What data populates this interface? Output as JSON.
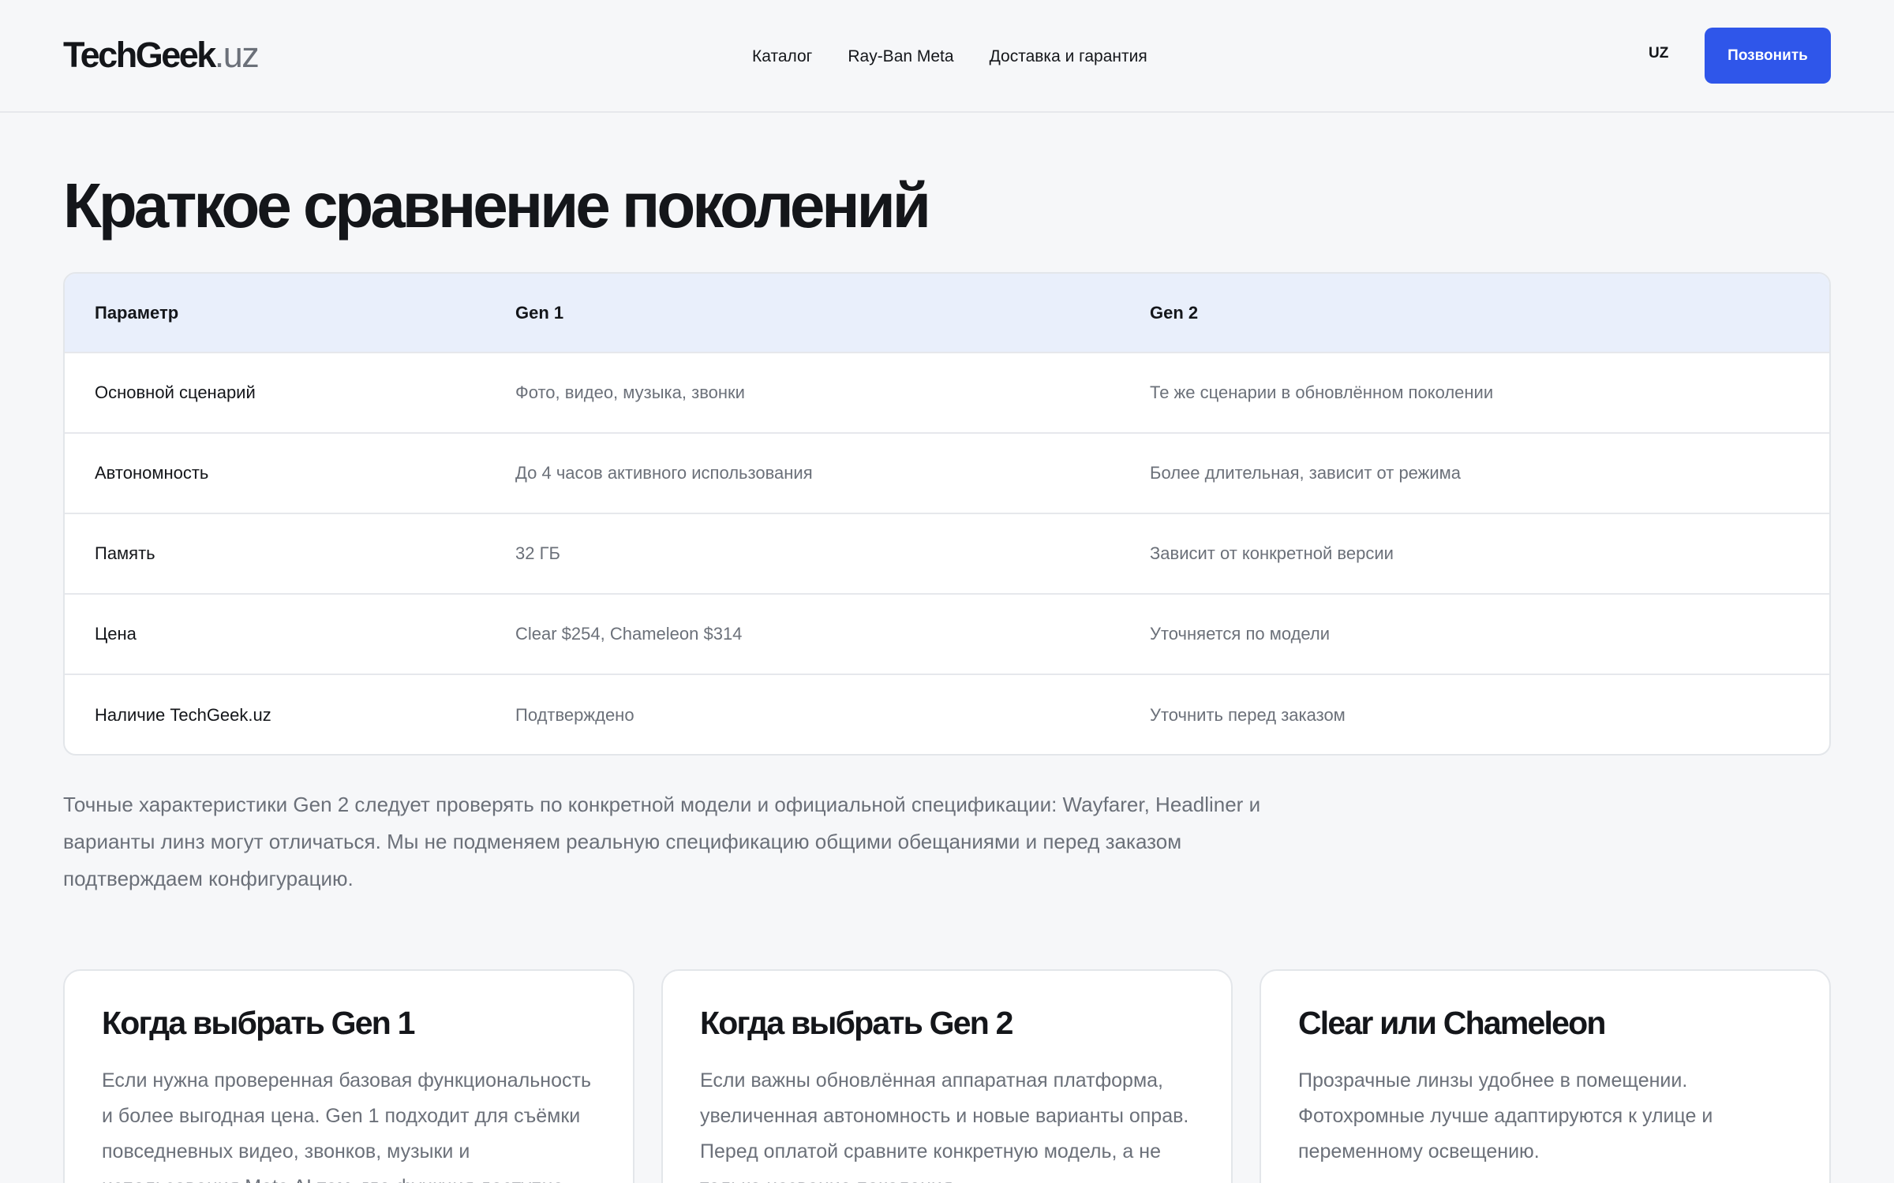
{
  "header": {
    "logo_main": "TechGeek",
    "logo_domain": ".uz",
    "nav": [
      {
        "label": "Каталог"
      },
      {
        "label": "Ray-Ban Meta"
      },
      {
        "label": "Доставка и гарантия"
      }
    ],
    "lang": "UZ",
    "call_label": "Позвонить"
  },
  "title": "Краткое сравнение поколений",
  "table": {
    "headers": [
      "Параметр",
      "Gen 1",
      "Gen 2"
    ],
    "rows": [
      [
        "Основной сценарий",
        "Фото, видео, музыка, звонки",
        "Те же сценарии в обновлённом поколении"
      ],
      [
        "Автономность",
        "До 4 часов активного использования",
        "Более длительная, зависит от режима"
      ],
      [
        "Память",
        "32 ГБ",
        "Зависит от конкретной версии"
      ],
      [
        "Цена",
        "Clear $254, Chameleon $314",
        "Уточняется по модели"
      ],
      [
        "Наличие TechGeek.uz",
        "Подтверждено",
        "Уточнить перед заказом"
      ]
    ]
  },
  "note": "Точные характеристики Gen 2 следует проверять по конкретной модели и официальной спецификации: Wayfarer, Headliner и варианты линз могут отличаться. Мы не подменяем реальную спецификацию общими обещаниями и перед заказом подтверждаем конфигурацию.",
  "cards": [
    {
      "title": "Когда выбрать Gen 1",
      "text": "Если нужна проверенная базовая функциональность и более выгодная цена. Gen 1 подходит для съёмки повседневных видео, звонков, музыки и использования Meta AI там, где функция доступна."
    },
    {
      "title": "Когда выбрать Gen 2",
      "text": "Если важны обновлённая аппаратная платформа, увеличенная автономность и новые варианты оправ. Перед оплатой сравните конкретную модель, а не только название поколения."
    },
    {
      "title": "Clear или Chameleon",
      "text": "Прозрачные линзы удобнее в помещении. Фотохромные лучше адаптируются к улице и переменному освещению."
    }
  ]
}
